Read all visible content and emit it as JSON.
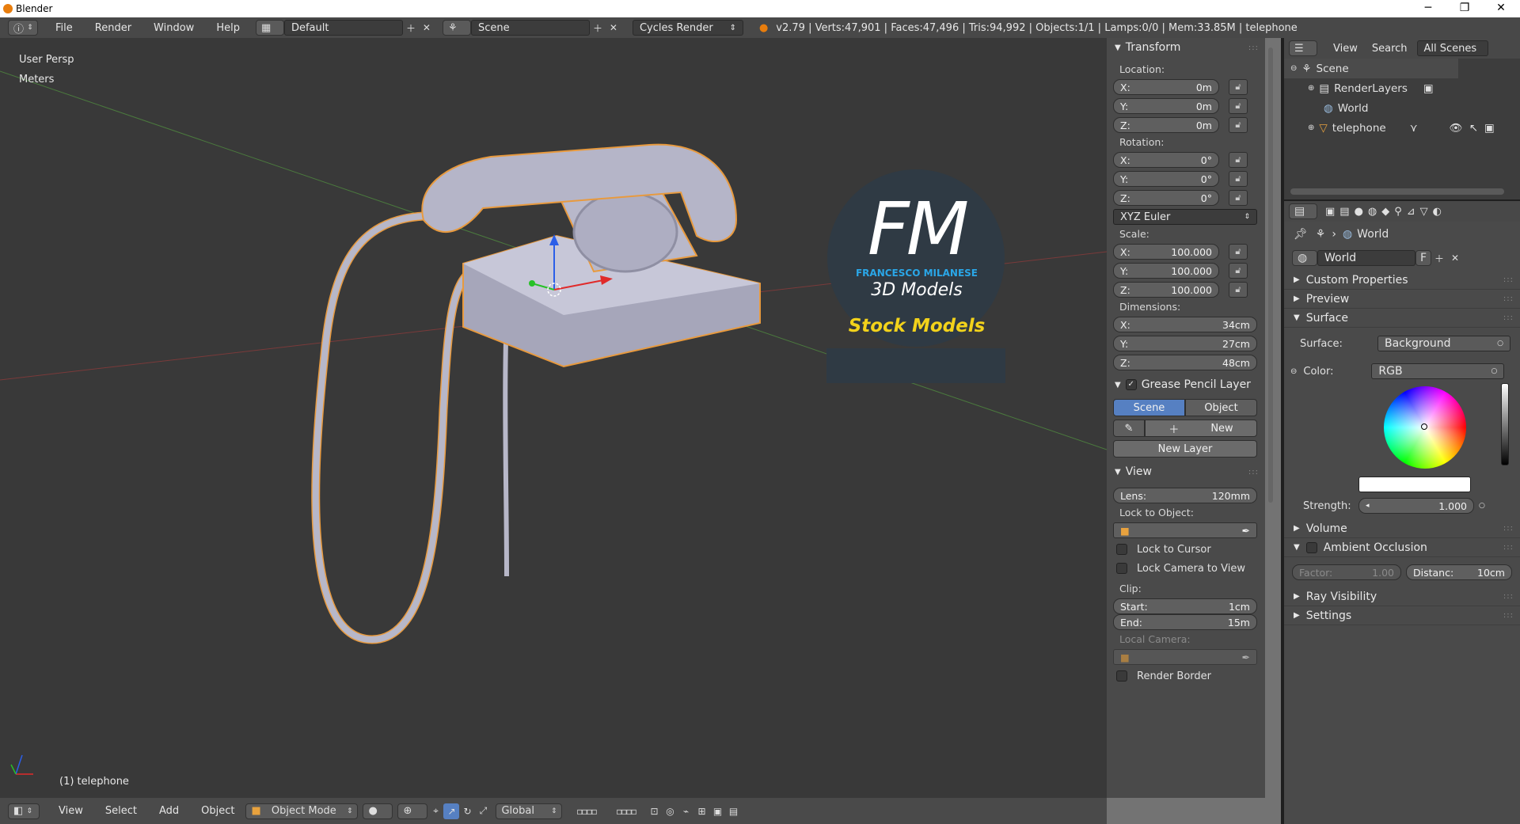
{
  "window": {
    "title": "Blender",
    "minimize": "─",
    "maximize": "❐",
    "close": "✕"
  },
  "info_header": {
    "menus": [
      "File",
      "Render",
      "Window",
      "Help"
    ],
    "layout": "Default",
    "scene": "Scene",
    "engine": "Cycles Render",
    "stats": "v2.79 | Verts:47,901 | Faces:47,496 | Tris:94,992 | Objects:1/1 | Lamps:0/0 | Mem:33.85M | telephone"
  },
  "viewport": {
    "view_name": "User Persp",
    "units": "Meters",
    "object_label": "(1) telephone",
    "watermark": {
      "initials": "FM",
      "company": "FRANCESCO MILANESE",
      "subtitle": "3D Models",
      "banner": "Stock Models"
    }
  },
  "viewport_footer": {
    "menus": [
      "View",
      "Select",
      "Add",
      "Object"
    ],
    "mode": "Object Mode",
    "orientation": "Global"
  },
  "n_panel": {
    "transform": {
      "title": "Transform",
      "location_label": "Location:",
      "location": [
        {
          "axis": "X:",
          "value": "0m"
        },
        {
          "axis": "Y:",
          "value": "0m"
        },
        {
          "axis": "Z:",
          "value": "0m"
        }
      ],
      "rotation_label": "Rotation:",
      "rotation": [
        {
          "axis": "X:",
          "value": "0°"
        },
        {
          "axis": "Y:",
          "value": "0°"
        },
        {
          "axis": "Z:",
          "value": "0°"
        }
      ],
      "rotation_mode": "XYZ Euler",
      "scale_label": "Scale:",
      "scale": [
        {
          "axis": "X:",
          "value": "100.000"
        },
        {
          "axis": "Y:",
          "value": "100.000"
        },
        {
          "axis": "Z:",
          "value": "100.000"
        }
      ],
      "dimensions_label": "Dimensions:",
      "dimensions": [
        {
          "axis": "X:",
          "value": "34cm"
        },
        {
          "axis": "Y:",
          "value": "27cm"
        },
        {
          "axis": "Z:",
          "value": "48cm"
        }
      ]
    },
    "grease_pencil": {
      "title": "Grease Pencil Layer",
      "tab_scene": "Scene",
      "tab_object": "Object",
      "new_label": "New",
      "new_layer_label": "New Layer"
    },
    "view": {
      "title": "View",
      "lens_label": "Lens:",
      "lens_value": "120mm",
      "lock_to_object_label": "Lock to Object:",
      "lock_to_cursor": "Lock to Cursor",
      "lock_camera": "Lock Camera to View",
      "clip_label": "Clip:",
      "clip_start_label": "Start:",
      "clip_start": "1cm",
      "clip_end_label": "End:",
      "clip_end": "15m",
      "local_camera_label": "Local Camera:",
      "render_border": "Render Border"
    }
  },
  "outliner": {
    "menus": [
      "View",
      "Search"
    ],
    "filter": "All Scenes",
    "items": [
      {
        "label": "Scene",
        "icon": "scene-icon"
      },
      {
        "label": "RenderLayers",
        "icon": "render-layers-icon"
      },
      {
        "label": "World",
        "icon": "world-icon"
      },
      {
        "label": "telephone",
        "icon": "object-icon"
      }
    ]
  },
  "properties": {
    "breadcrumb": "World",
    "world_name": "World",
    "fake_user": "F",
    "sections": {
      "custom_properties": "Custom Properties",
      "preview": "Preview",
      "surface": "Surface",
      "volume": "Volume",
      "ambient_occlusion": "Ambient Occlusion",
      "ray_visibility": "Ray Visibility",
      "settings": "Settings"
    },
    "surface_label": "Surface:",
    "surface_value": "Background",
    "color_label": "Color:",
    "color_mode": "RGB",
    "strength_label": "Strength:",
    "strength_value": "1.000",
    "ao_factor_label": "Factor:",
    "ao_factor": "1.00",
    "ao_distance_label": "Distanc:",
    "ao_distance": "10cm"
  },
  "colors": {
    "accent": "#5680c2",
    "selected_outline": "#f39c38",
    "banner_text": "#f2d21b",
    "fm_blue": "#2aa7e8"
  }
}
